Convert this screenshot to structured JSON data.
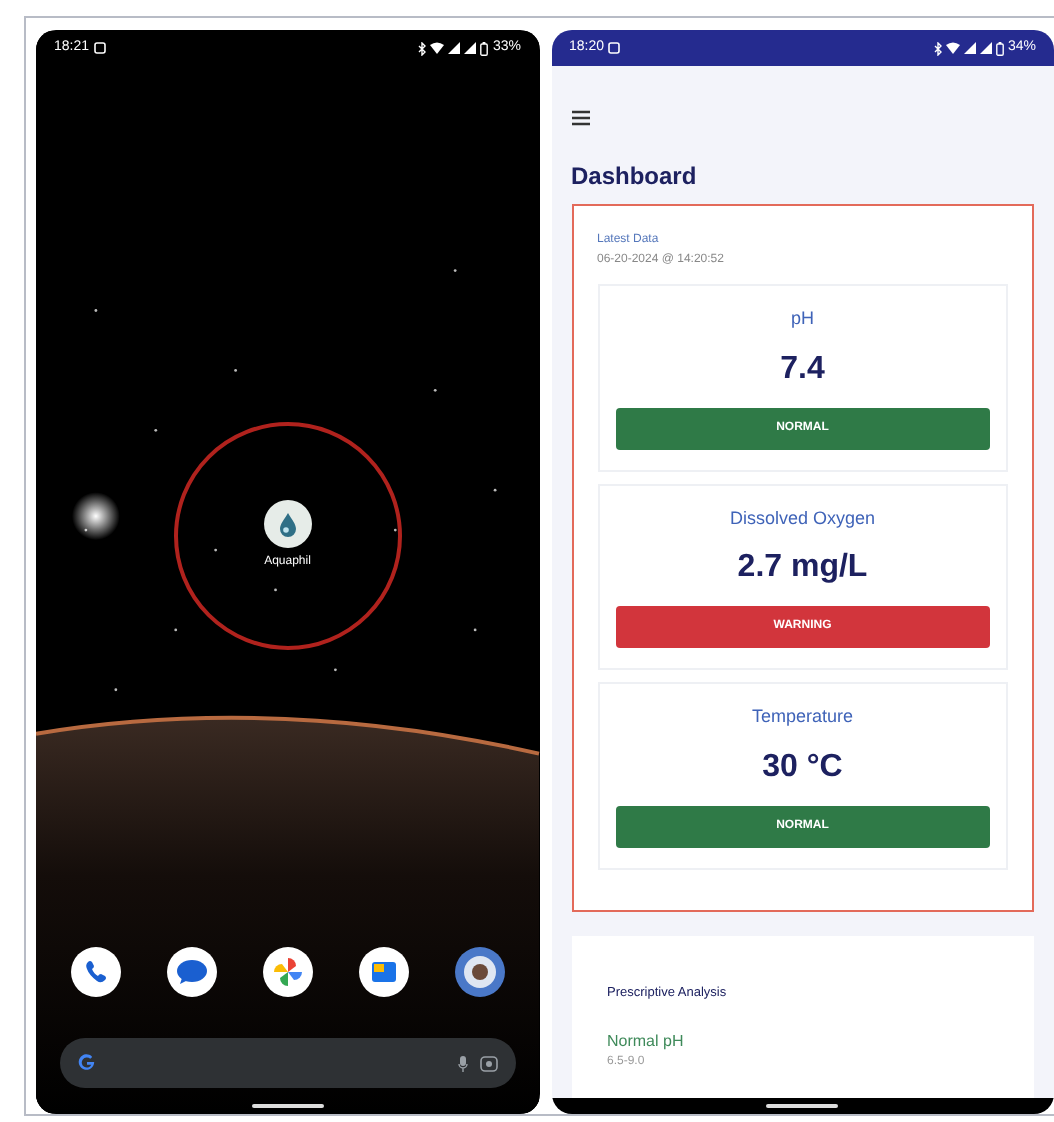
{
  "home_screen": {
    "status_bar": {
      "time": "18:21",
      "battery": "33%"
    },
    "app_icon": {
      "label": "Aquaphil",
      "highlighted": true
    }
  },
  "app_screen": {
    "status_bar": {
      "time": "18:20",
      "battery": "34%"
    },
    "title": "Dashboard",
    "latest_data": {
      "label": "Latest Data",
      "timestamp": "06-20-2024 @ 14:20:52",
      "highlighted": true
    },
    "metrics": [
      {
        "name": "pH",
        "value": "7.4",
        "status": "NORMAL",
        "kind": "normal"
      },
      {
        "name": "Dissolved Oxygen",
        "value": "2.7 mg/L",
        "status": "WARNING",
        "kind": "warning"
      },
      {
        "name": "Temperature",
        "value": "30 °C",
        "status": "NORMAL",
        "kind": "normal"
      }
    ],
    "analysis": {
      "title": "Prescriptive Analysis",
      "items": [
        {
          "title": "Normal pH",
          "range": "6.5-9.0"
        }
      ]
    }
  }
}
